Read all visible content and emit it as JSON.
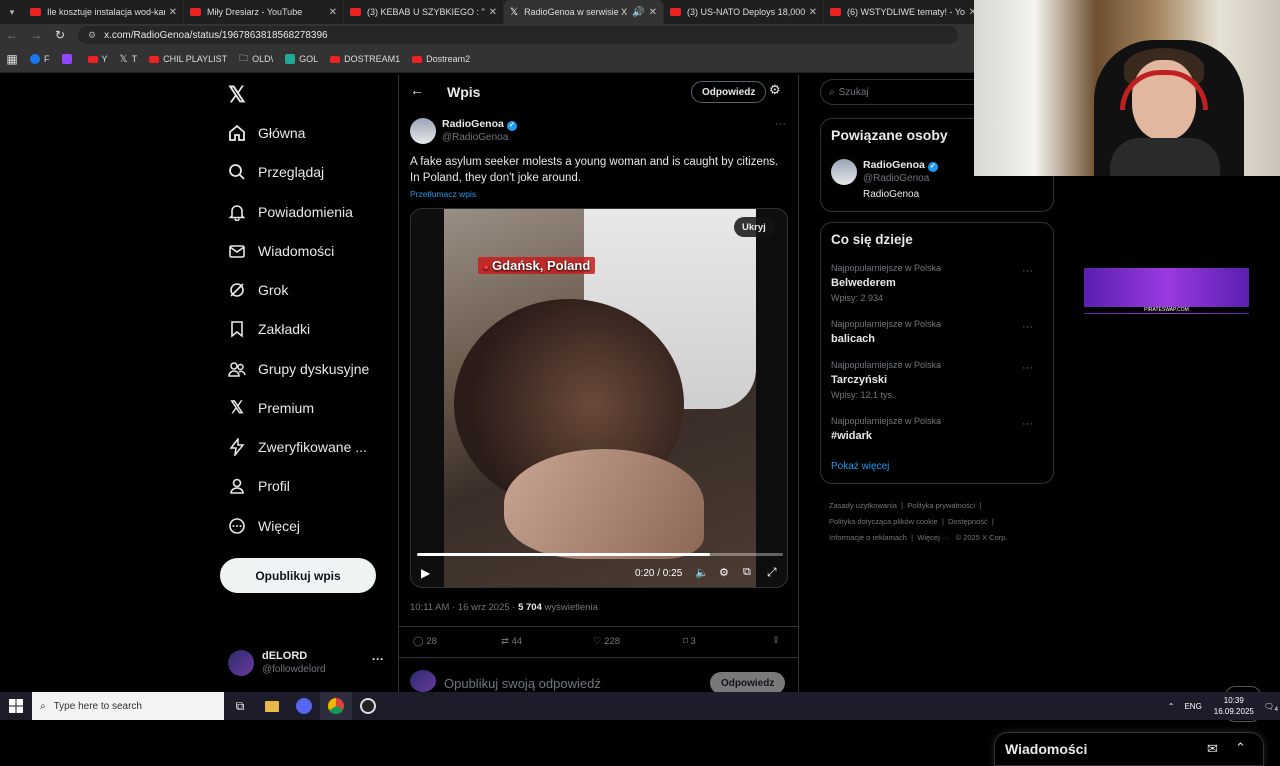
{
  "browser": {
    "tabs": [
      {
        "label": "Ile kosztuje instalacja wod-kan",
        "icon": "youtube-icon",
        "active": false
      },
      {
        "label": "Miły Dresiarz - YouTube",
        "icon": "youtube-icon",
        "active": false
      },
      {
        "label": "(3) KEBAB U SZYBKIEGO : \"Spró",
        "icon": "youtube-icon",
        "active": false
      },
      {
        "label": "RadioGenoa w serwisie X: „A",
        "icon": "x-icon",
        "active": true
      },
      {
        "label": "(3) US-NATO Deploys 18,000 El",
        "icon": "youtube-icon",
        "active": false
      },
      {
        "label": "(6) WSTYDLIWE tematy! - YouTu",
        "icon": "youtube-icon",
        "active": false
      }
    ],
    "url": "x.com/RadioGenoa/status/1967863818568278396",
    "bookmarks": [
      {
        "label": "F",
        "color": "#1877f2"
      },
      {
        "label": "",
        "color": "#9146ff"
      },
      {
        "label": "Y",
        "color": "#e22"
      },
      {
        "label": "T",
        "color": "#000"
      },
      {
        "label": "CHIL PLAYLIST",
        "color": "#e22"
      },
      {
        "label": "OLD\\",
        "color": "#888"
      },
      {
        "label": "GOL",
        "color": "#2a9"
      },
      {
        "label": "DOSTREAM1",
        "color": "#e22"
      },
      {
        "label": "Dostream2",
        "color": "#e22"
      }
    ]
  },
  "sidebar": {
    "items": [
      {
        "label": "Główna",
        "icon": "home-icon"
      },
      {
        "label": "Przeglądaj",
        "icon": "search-icon"
      },
      {
        "label": "Powiadomienia",
        "icon": "bell-icon"
      },
      {
        "label": "Wiadomości",
        "icon": "mail-icon"
      },
      {
        "label": "Grok",
        "icon": "grok-icon"
      },
      {
        "label": "Zakładki",
        "icon": "bookmark-icon"
      },
      {
        "label": "Grupy dyskusyjne",
        "icon": "people-icon"
      },
      {
        "label": "Premium",
        "icon": "x-icon"
      },
      {
        "label": "Zweryfikowane ...",
        "icon": "bolt-icon"
      },
      {
        "label": "Profil",
        "icon": "person-icon"
      },
      {
        "label": "Więcej",
        "icon": "more-circle-icon"
      }
    ],
    "post_button": "Opublikuj wpis",
    "user": {
      "name": "dELORD",
      "handle": "@followdelord"
    }
  },
  "main": {
    "title": "Wpis",
    "reply_button": "Odpowiedz",
    "author": {
      "name": "RadioGenoa",
      "handle": "@RadioGenoa"
    },
    "text": "A fake asylum seeker molests a young woman and is caught by citizens. In Poland, they don't joke around.",
    "translate": "Przetłumacz wpis",
    "video": {
      "hide_label": "Ukryj",
      "location_caption": "Gdańsk, Poland",
      "time": "0:20 / 0:25",
      "progress": 0.8
    },
    "meta": {
      "time": "10:11 AM · 16 wrz 2025 · ",
      "views": "5 704",
      "views_label": " wyświetlenia"
    },
    "actions": {
      "replies": "28",
      "reposts": "44",
      "likes": "228",
      "bookmarks": "3"
    },
    "reply_placeholder": "Opublikuj swoją odpowiedź",
    "reply_submit": "Odpowiedz"
  },
  "right": {
    "search_placeholder": "Szukaj",
    "related_title": "Powiązane osoby",
    "related": {
      "name": "RadioGenoa",
      "handle": "@RadioGenoa",
      "bio": "RadioGenoa"
    },
    "trends_title": "Co się dzieje",
    "trends": [
      {
        "meta": "Najpopularniejsze w Polska",
        "name": "Belwederem",
        "count": "Wpisy: 2 934"
      },
      {
        "meta": "Najpopularniejsze w Polska",
        "name": "balicach",
        "count": ""
      },
      {
        "meta": "Najpopularniejsze w Polska",
        "name": "Tarczyński",
        "count": "Wpisy: 12,1 tys."
      },
      {
        "meta": "Najpopularniejsze w Polska",
        "name": "#widark",
        "count": ""
      }
    ],
    "show_more": "Pokaż więcej",
    "footer": [
      "Zasady użytkowania",
      "Polityka prywatności",
      "Polityka dotycząca plików cookie",
      "Dostępność",
      "Informacje o reklamach",
      "Więcej ···",
      "© 2025 X Corp."
    ]
  },
  "ad": {
    "caption": "PIRATESWAP.COM"
  },
  "dm_drawer": {
    "title": "Wiadomości"
  },
  "taskbar": {
    "search_placeholder": "Type here to search",
    "lang": "ENG",
    "time": "10:39",
    "date": "16.09.2025",
    "notifications": "4"
  },
  "colors": {
    "accent": "#1d9bf0",
    "background": "#000000",
    "border": "#2f3336",
    "muted": "#71767b"
  }
}
